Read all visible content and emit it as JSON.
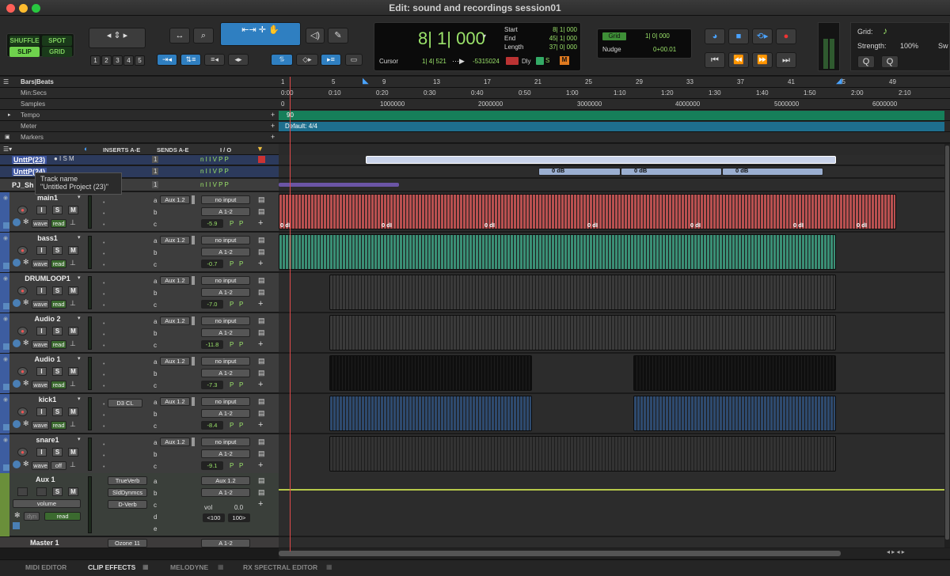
{
  "window": {
    "title": "Edit: sound and recordings session01"
  },
  "colors": {
    "accent": "#2f7fc1",
    "tempo": "#167f5a",
    "meter": "#1e6f8e",
    "audio_red": "#b95050",
    "bass_green": "#3a8f75",
    "selection": "#9bb6d9"
  },
  "edit_modes": {
    "shuffle": "SHUFFLE",
    "spot": "SPOT",
    "slip": "SLIP",
    "grid": "GRID"
  },
  "zoom_presets": [
    "1",
    "2",
    "3",
    "4",
    "5"
  ],
  "counter": {
    "main": "8| 1| 000",
    "start_label": "Start",
    "start": "8| 1| 000",
    "end_label": "End",
    "end": "45| 1| 000",
    "length_label": "Length",
    "length": "37| 0| 000",
    "cursor_label": "Cursor",
    "cursor": "1| 4| 521",
    "samples": "-5315024",
    "dly": "Dly",
    "s": "S",
    "m": "M"
  },
  "grid": {
    "label": "Grid",
    "value": "1| 0| 000",
    "nudge_label": "Nudge",
    "nudge_value": "0+00.01"
  },
  "rightpanel": {
    "grid_label": "Grid:",
    "strength_label": "Strength:",
    "strength_value": "100%",
    "swing_label": "Sw",
    "q1": "Q",
    "q2": "Q"
  },
  "rulers": {
    "bars_label": "Bars|Beats",
    "minsecs_label": "Min:Secs",
    "samples_label": "Samples",
    "tempo_label": "Tempo",
    "meter_label": "Meter",
    "markers_label": "Markers",
    "bars": [
      "1",
      "5",
      "9",
      "13",
      "17",
      "21",
      "25",
      "29",
      "33",
      "37",
      "41",
      "45",
      "49"
    ],
    "minsecs": [
      "0:00",
      "0:10",
      "0:20",
      "0:30",
      "0:40",
      "0:50",
      "1:00",
      "1:10",
      "1:20",
      "1:30",
      "1:40",
      "1:50",
      "2:00",
      "2:10"
    ],
    "samples": [
      "0",
      "1000000",
      "2000000",
      "3000000",
      "4000000",
      "5000000",
      "6000000"
    ],
    "tempo_value": "90",
    "meter_value": "Default: 4/4"
  },
  "mixer_headers": {
    "inserts": "INSERTS A-E",
    "sends": "SENDS A-E",
    "io": "I / O"
  },
  "tooltip": {
    "title": "Track name",
    "value": "\"Untitled Project (23)\""
  },
  "tracks": [
    {
      "name": "UnttP(23)"
    },
    {
      "name": "UnttP(24)"
    },
    {
      "name": "PJ_Sh"
    },
    {
      "name": "main1",
      "send": "Aux 1.2",
      "input": "no input",
      "output": "A 1-2",
      "vol": "-5.9",
      "view": "wave",
      "auto": "read"
    },
    {
      "name": "bass1",
      "send": "Aux 1.2",
      "input": "no input",
      "output": "A 1-2",
      "vol": "-0.7",
      "view": "wave",
      "auto": "read"
    },
    {
      "name": "DRUMLOOP1",
      "send": "Aux 1.2",
      "input": "no input",
      "output": "A 1-2",
      "vol": "-7.0",
      "view": "wave",
      "auto": "read"
    },
    {
      "name": "Audio 2",
      "send": "Aux 1.2",
      "input": "no input",
      "output": "A 1-2",
      "vol": "-11.8",
      "view": "wave",
      "auto": "read"
    },
    {
      "name": "Audio 1",
      "send": "Aux 1.2",
      "input": "no input",
      "output": "A 1-2",
      "vol": "-7.3",
      "view": "wave",
      "auto": "read"
    },
    {
      "name": "kick1",
      "insert": "D3 CL",
      "send": "Aux 1.2",
      "input": "no input",
      "output": "A 1-2",
      "vol": "-8.4",
      "view": "wave",
      "auto": "read"
    },
    {
      "name": "snare1",
      "send": "Aux 1.2",
      "input": "no input",
      "output": "A 1-2",
      "vol": "-9.1",
      "view": "wave",
      "auto": "off"
    },
    {
      "name": "Aux 1",
      "inserts": [
        "TrueVerb",
        "SldDynmcs",
        "D-Verb"
      ],
      "input": "Aux 1.2",
      "output": "A 1-2",
      "vol_label": "vol",
      "vol": "0.0",
      "pan_l": "<100",
      "pan_r": "100>",
      "view": "volume",
      "dyn": "dyn",
      "auto": "read"
    },
    {
      "name": "Master 1",
      "insert": "Ozone 11",
      "output": "A 1-2"
    }
  ],
  "send_slots": [
    "a",
    "b",
    "c",
    "d",
    "e"
  ],
  "pp": "P",
  "clip_gain": "0 dB",
  "clip_gain_cut": "0 dI",
  "bottom_tabs": [
    "MIDI EDITOR",
    "CLIP EFFECTS",
    "MELODYNE",
    "RX SPECTRAL EDITOR"
  ]
}
